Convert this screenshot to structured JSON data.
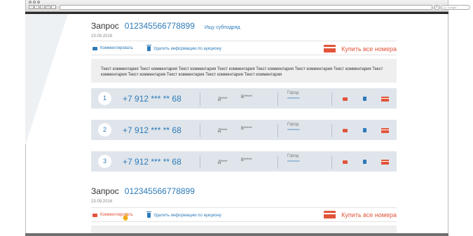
{
  "browser": {
    "search_placeholder": "Q- Google",
    "reload_glyph": "c"
  },
  "requests": [
    {
      "label": "Запрос",
      "number": "012345566778899",
      "link": "Ищу субподряд",
      "date": "23.09.2016",
      "comment_action": "Комментировать",
      "delete_action": "Удалить информацию по аукциону",
      "buy_label": "Купить все номера",
      "comment_text": "Текст комментария Текст комментария Текст комментария Текст комментария Текст комментария Текст комментария Текст комментария Текст комментария Текст комментария Текст комментария Текст комментария Текст комментария",
      "rows": [
        {
          "index": "1",
          "phone": "+7 912 *** ** 68",
          "name1": "Д****",
          "name2": "В*****",
          "city_label": "Город",
          "city_value": "*********"
        },
        {
          "index": "2",
          "phone": "+7 912 *** ** 68",
          "name1": "Д****",
          "name2": "В*****",
          "city_label": "Город",
          "city_value": "*********"
        },
        {
          "index": "3",
          "phone": "+7 912 *** ** 68",
          "name1": "Д****",
          "name2": "В*****",
          "city_label": "Город",
          "city_value": "*********"
        }
      ]
    },
    {
      "label": "Запрос",
      "number": "012345566778899",
      "date": "23.09.2016",
      "comment_action": "Комментировать",
      "delete_action": "Удалить информацию по аукциону",
      "buy_label": "Купить все номера"
    }
  ],
  "colors": {
    "accent": "#2e7ab8",
    "danger": "#e2543a",
    "row_bg": "#dfe5eb"
  }
}
